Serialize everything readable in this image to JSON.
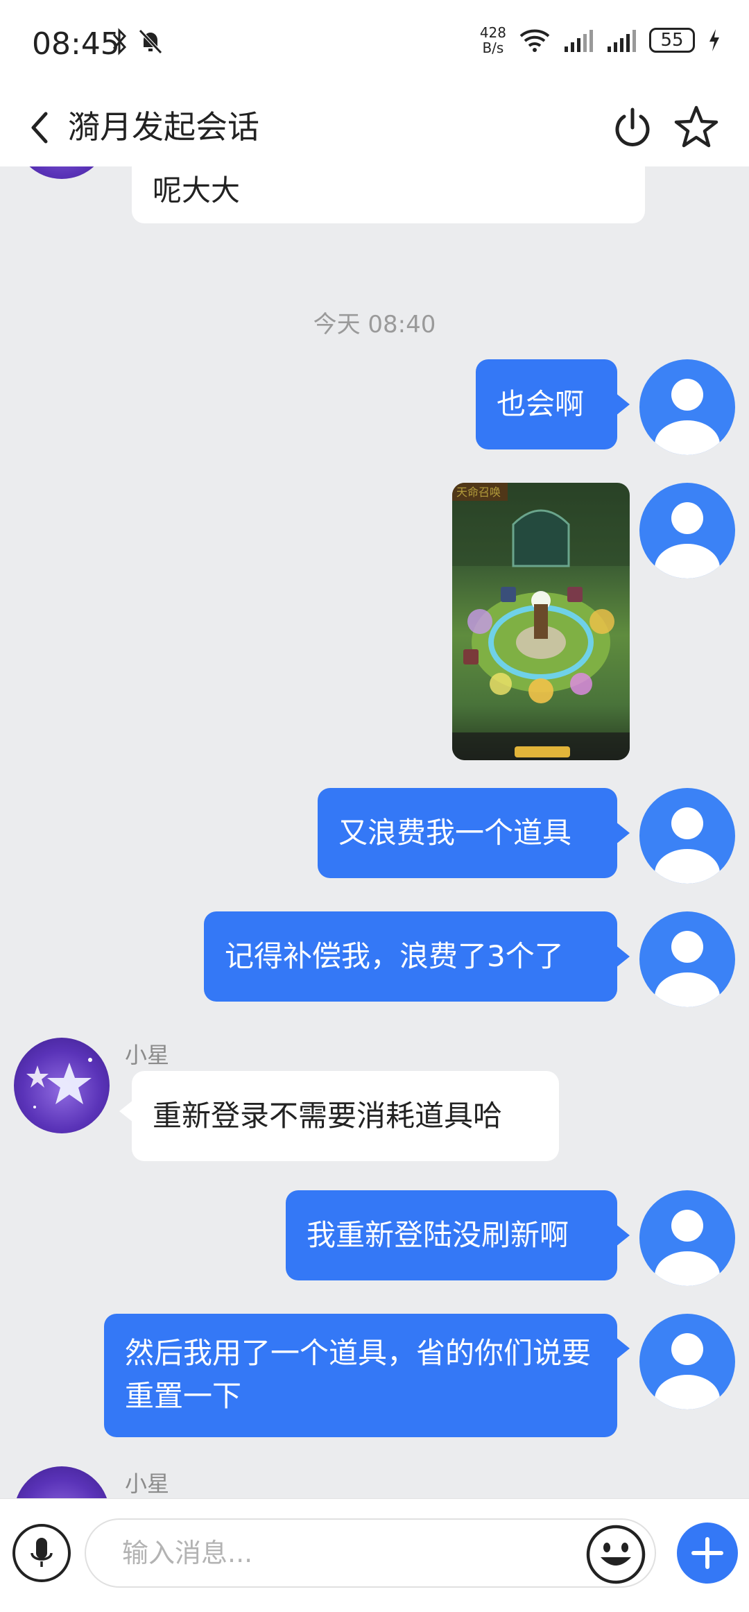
{
  "status_bar": {
    "time": "08:45",
    "net_speed_value": "428",
    "net_speed_unit": "B/s",
    "battery": "55"
  },
  "header": {
    "title": "漪月发起会话"
  },
  "chat": {
    "partial_top_message": "呢大大",
    "timestamp": "今天 08:40",
    "messages": [
      {
        "text": "也会啊"
      },
      {
        "image": "game-screenshot"
      },
      {
        "text": "又浪费我一个道具"
      },
      {
        "text": "记得补偿我，浪费了3个了"
      },
      {
        "sender": "小星",
        "text": "重新登录不需要消耗道具哈"
      },
      {
        "text": "我重新登陆没刷新啊"
      },
      {
        "text": "然后我用了一个道具，省的你们说要重置一下"
      },
      {
        "sender": "小星"
      }
    ]
  },
  "input_bar": {
    "placeholder": "输入消息..."
  },
  "colors": {
    "accent": "#3478f6",
    "chat_background": "#ebecee",
    "incoming_bubble": "#ffffff"
  }
}
